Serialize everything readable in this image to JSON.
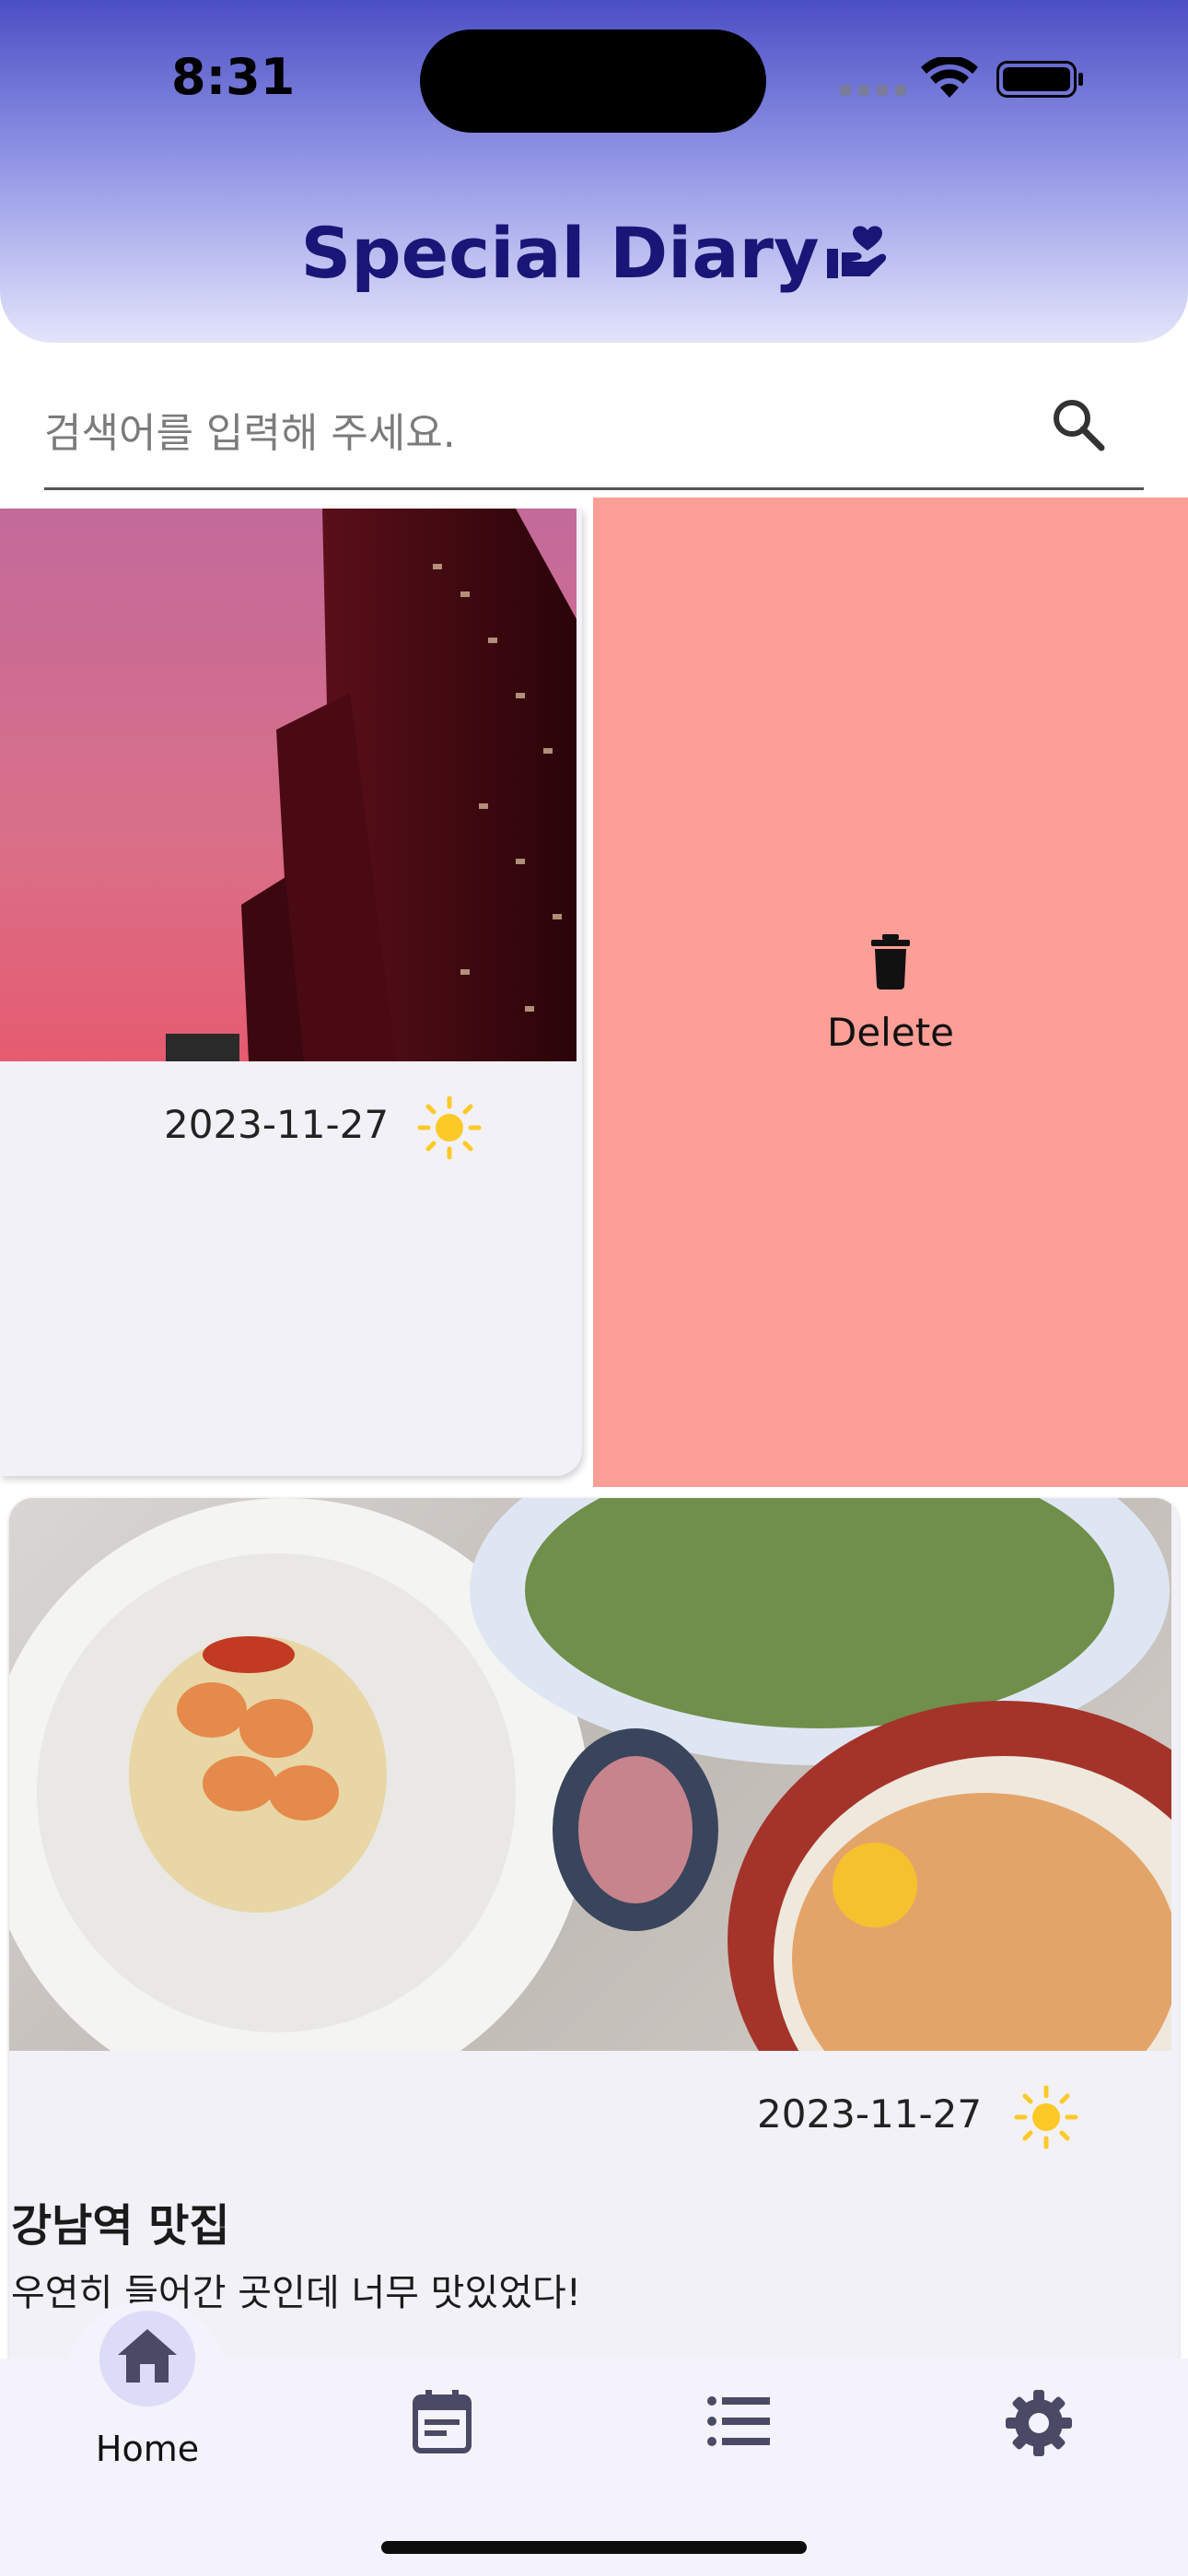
{
  "status_bar": {
    "time": "8:31"
  },
  "header": {
    "title": "Special Diary"
  },
  "search": {
    "placeholder": "검색어를 입력해 주세요."
  },
  "diary_entries": [
    {
      "date": "2023-11-27",
      "weather": "sunny",
      "title": "",
      "body": ""
    },
    {
      "date": "2023-11-27",
      "weather": "sunny",
      "title": "강남역 맛집",
      "body": "우연히 들어간 곳인데 너무 맛있었다!"
    }
  ],
  "swipe_action": {
    "label": "Delete"
  },
  "bottom_nav": {
    "items": [
      {
        "label": "Home",
        "icon": "home-icon",
        "selected": true
      },
      {
        "label": "",
        "icon": "calendar-icon"
      },
      {
        "label": "",
        "icon": "list-icon"
      },
      {
        "label": "",
        "icon": "settings-icon"
      }
    ]
  },
  "colors": {
    "title": "#1a1677",
    "delete_bg": "#fe9f97",
    "sun": "#fcc927",
    "nav_selected_pill": "#dcdcf8"
  }
}
